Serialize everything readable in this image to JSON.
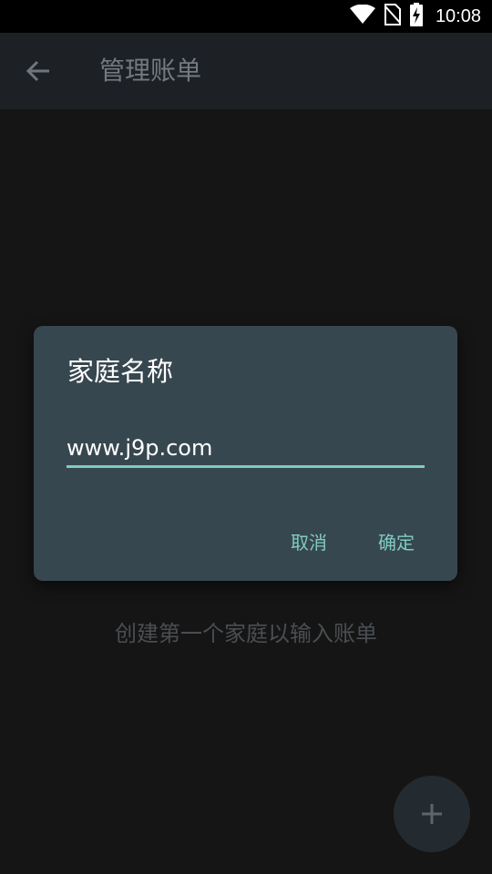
{
  "status_bar": {
    "time": "10:08",
    "icons": [
      "wifi-icon",
      "no-sim-icon",
      "battery-charging-icon"
    ]
  },
  "app_bar": {
    "title": "管理账单",
    "back_icon": "arrow-left-icon"
  },
  "main": {
    "empty_text": "创建第一个家庭以输入账单"
  },
  "fab": {
    "icon": "plus-icon"
  },
  "dialog": {
    "title": "家庭名称",
    "input_value": "www.j9p.com",
    "cancel_label": "取消",
    "confirm_label": "确定"
  },
  "colors": {
    "background": "#151515",
    "app_bar": "#1d2125",
    "dialog": "#37474f",
    "accent": "#80cbc4",
    "fab": "#242b30"
  }
}
